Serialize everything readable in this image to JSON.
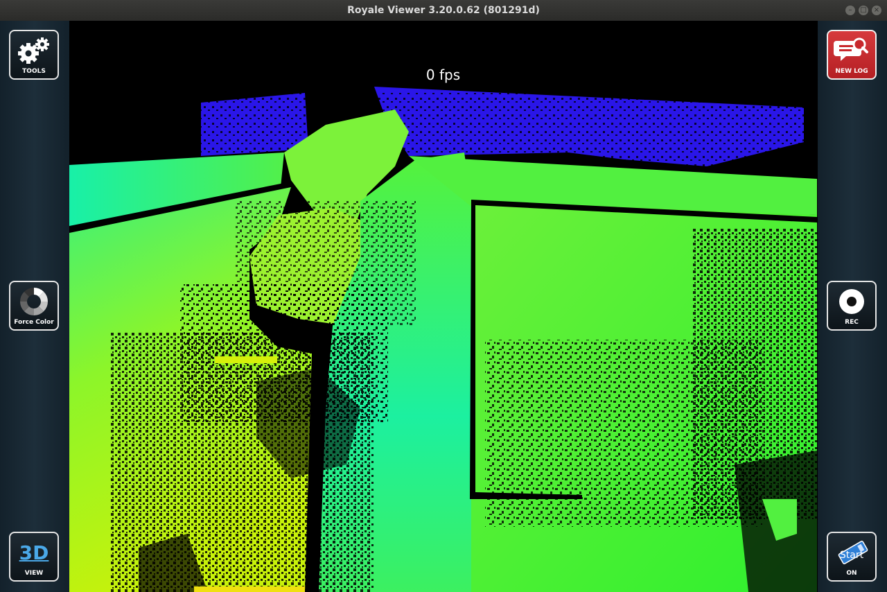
{
  "window": {
    "title": "Royale Viewer 3.20.0.62 (801291d)"
  },
  "viewport": {
    "fps_label": "0 fps"
  },
  "buttons": {
    "tools": "TOOLS",
    "force_color": "Force Color",
    "view": "VIEW",
    "view_icon_text": "3D",
    "new_log": "NEW LOG",
    "rec": "REC",
    "start": "ON",
    "start_icon_text": "Start"
  },
  "colors": {
    "sidebar": "#1d2e3a",
    "new_log_button": "#c8282c",
    "depth_far": "#2a16e8",
    "depth_mid": "#2cf04a",
    "depth_near": "#c8f20a"
  }
}
